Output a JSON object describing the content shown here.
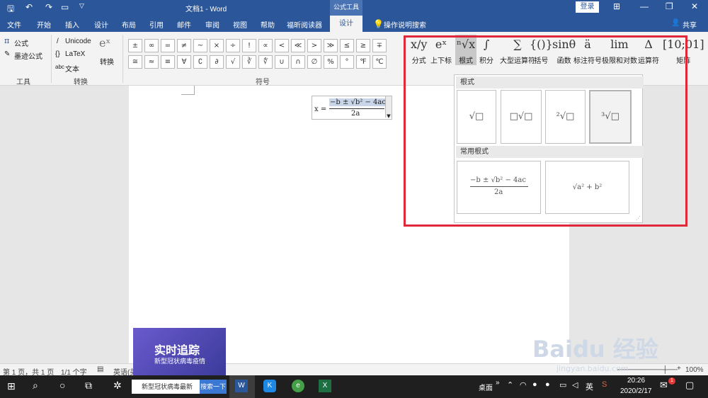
{
  "window": {
    "title": "文档1 - Word",
    "context_tools_label": "公式工具",
    "login_label": "登录",
    "share_label": "共享"
  },
  "tabs": [
    "文件",
    "开始",
    "插入",
    "设计",
    "布局",
    "引用",
    "邮件",
    "审阅",
    "视图",
    "帮助",
    "福昕阅读器",
    "设计"
  ],
  "tell_me": "操作说明搜索",
  "ribbon": {
    "tools_group": {
      "equation": "公式",
      "ink_equation": "墨迹公式",
      "label": "工具"
    },
    "convert_group": {
      "unicode": "Unicode",
      "latex": "LaTeX",
      "text": "文本",
      "convert": "转换",
      "label": "转换"
    },
    "symbols_label": "符号",
    "symbols_row1": [
      "±",
      "∞",
      "=",
      "≠",
      "~",
      "×",
      "÷",
      "!",
      "∝",
      "<",
      "≪",
      ">",
      "≫",
      "≤",
      "≥",
      "∓"
    ],
    "symbols_row2": [
      "≅",
      "≈",
      "≡",
      "∀",
      "∁",
      "∂",
      "√",
      "∛",
      "∜",
      "∪",
      "∩",
      "∅",
      "%",
      "°",
      "℉",
      "℃"
    ],
    "structures": [
      {
        "icon": "x/y",
        "label": "分式"
      },
      {
        "icon": "eˣ",
        "label": "上下标"
      },
      {
        "icon": "ⁿ√x",
        "label": "根式"
      },
      {
        "icon": "∫",
        "label": "积分"
      },
      {
        "icon": "∑",
        "label": "大型运算符"
      },
      {
        "icon": "{()}",
        "label": "括号"
      },
      {
        "icon": "sinθ",
        "label": "函数"
      },
      {
        "icon": "ä",
        "label": "标注符号"
      },
      {
        "icon": "lim",
        "label": "极限和对数"
      },
      {
        "icon": "Δ",
        "label": "运算符"
      },
      {
        "icon": "[10;01]",
        "label": "矩阵"
      }
    ]
  },
  "equation_in_doc": {
    "lhs": "x =",
    "numerator": "−b ± √b² − 4ac",
    "denominator": "2a"
  },
  "radical_panel": {
    "section1": "根式",
    "section2": "常用根式",
    "common1_numerator": "−b ± √b² − 4ac",
    "common1_denominator": "2a",
    "common2": "√a² + b²"
  },
  "status_bar": {
    "page": "第 1 页，共 1 页",
    "words": "1/1 个字",
    "lang": "英语(美",
    "zoom": "100%"
  },
  "taskbar": {
    "search_text": "新型冠状病毒最新",
    "search_button": "搜索一下",
    "desktop_label": "桌面",
    "ime": "英",
    "time": "20:26",
    "date": "2020/2/17",
    "notif_count": "1"
  },
  "ad": {
    "title": "实时追踪",
    "subtitle": "新型冠状病毒疫情"
  },
  "watermark": {
    "brand": "Baidu 经验",
    "url": "jingyan.baidu.com"
  }
}
